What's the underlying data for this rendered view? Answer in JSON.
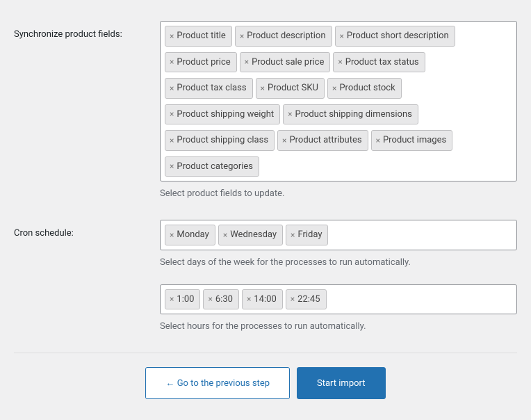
{
  "sync_fields": {
    "label": "Synchronize product fields:",
    "helper": "Select product fields to update.",
    "tags": [
      "Product title",
      "Product description",
      "Product short description",
      "Product price",
      "Product sale price",
      "Product tax status",
      "Product tax class",
      "Product SKU",
      "Product stock",
      "Product shipping weight",
      "Product shipping dimensions",
      "Product shipping class",
      "Product attributes",
      "Product images",
      "Product categories"
    ]
  },
  "cron_schedule": {
    "label": "Cron schedule:",
    "days_helper": "Select days of the week for the processes to run automatically.",
    "hours_helper": "Select hours for the processes to run automatically.",
    "days": [
      "Monday",
      "Wednesday",
      "Friday"
    ],
    "hours": [
      "1:00",
      "6:30",
      "14:00",
      "22:45"
    ]
  },
  "buttons": {
    "prev": "← Go to the previous step",
    "start": "Start import"
  }
}
